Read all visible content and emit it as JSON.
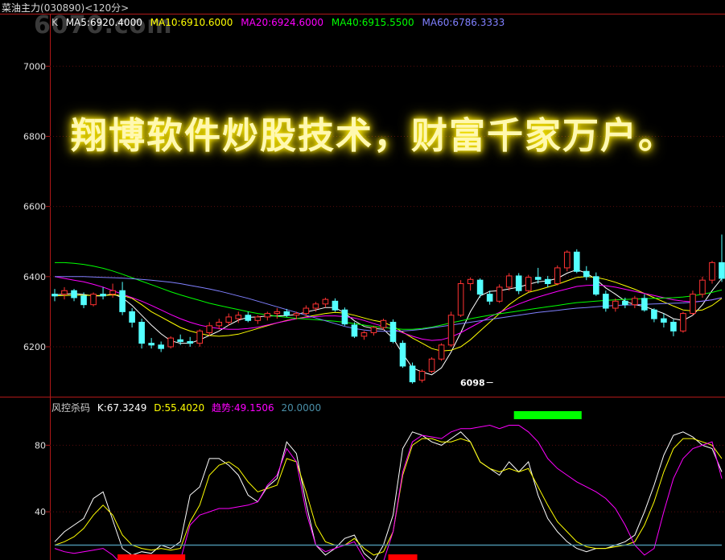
{
  "header": {
    "instrument": "菜油主力",
    "code": "(030890)",
    "period": "<120分>",
    "watermark": "6070.com"
  },
  "overlay_text": "翔博软件炒股技术，财富千家万户。",
  "ma_legend": [
    {
      "label": "K",
      "color": "#cfcfcf"
    },
    {
      "label": "MA5:6920.4000",
      "color": "#ffffff"
    },
    {
      "label": "MA10:6910.6000",
      "color": "#ffff00"
    },
    {
      "label": "MA20:6924.6000",
      "color": "#ff00ff"
    },
    {
      "label": "MA40:6915.5500",
      "color": "#00ff00"
    },
    {
      "label": "MA60:6786.3333",
      "color": "#8080ff"
    }
  ],
  "indicator_legend": [
    {
      "label": "风控杀码",
      "color": "#cfcfcf"
    },
    {
      "label": "K:67.3249",
      "color": "#ffffff"
    },
    {
      "label": "D:55.4020",
      "color": "#ffff00"
    },
    {
      "label": "趋势:49.1506",
      "color": "#ff00ff"
    },
    {
      "label": "20.0000",
      "color": "#4a8fa8"
    }
  ],
  "chart_data": [
    {
      "type": "candlestick",
      "title": "菜油主力 (030890) <120分>",
      "ylim": [
        6060,
        7120
      ],
      "yticks": [
        6200,
        6400,
        6600,
        6800,
        7000
      ],
      "annotations": [
        {
          "text": "6098",
          "bar": 45,
          "value": 6098
        }
      ],
      "candles": [
        [
          6350,
          6365,
          6330,
          6345
        ],
        [
          6350,
          6370,
          6335,
          6360
        ],
        [
          6360,
          6365,
          6330,
          6340
        ],
        [
          6345,
          6355,
          6310,
          6320
        ],
        [
          6320,
          6355,
          6315,
          6350
        ],
        [
          6350,
          6370,
          6335,
          6345
        ],
        [
          6350,
          6380,
          6340,
          6360
        ],
        [
          6360,
          6385,
          6290,
          6300
        ],
        [
          6300,
          6310,
          6255,
          6270
        ],
        [
          6270,
          6280,
          6195,
          6210
        ],
        [
          6210,
          6225,
          6195,
          6205
        ],
        [
          6205,
          6215,
          6185,
          6195
        ],
        [
          6200,
          6230,
          6195,
          6225
        ],
        [
          6220,
          6235,
          6205,
          6215
        ],
        [
          6215,
          6228,
          6200,
          6210
        ],
        [
          6210,
          6250,
          6200,
          6245
        ],
        [
          6240,
          6270,
          6232,
          6260
        ],
        [
          6260,
          6280,
          6250,
          6270
        ],
        [
          6270,
          6295,
          6260,
          6285
        ],
        [
          6280,
          6300,
          6268,
          6290
        ],
        [
          6290,
          6300,
          6270,
          6275
        ],
        [
          6275,
          6290,
          6265,
          6285
        ],
        [
          6285,
          6300,
          6275,
          6295
        ],
        [
          6295,
          6310,
          6280,
          6300
        ],
        [
          6300,
          6308,
          6285,
          6290
        ],
        [
          6290,
          6300,
          6278,
          6295
        ],
        [
          6295,
          6318,
          6288,
          6310
        ],
        [
          6310,
          6328,
          6300,
          6322
        ],
        [
          6322,
          6340,
          6312,
          6335
        ],
        [
          6330,
          6338,
          6300,
          6305
        ],
        [
          6305,
          6312,
          6260,
          6265
        ],
        [
          6262,
          6270,
          6225,
          6230
        ],
        [
          6230,
          6245,
          6220,
          6240
        ],
        [
          6240,
          6260,
          6232,
          6255
        ],
        [
          6255,
          6280,
          6248,
          6275
        ],
        [
          6270,
          6278,
          6210,
          6215
        ],
        [
          6210,
          6218,
          6140,
          6145
        ],
        [
          6145,
          6155,
          6095,
          6100
        ],
        [
          6105,
          6135,
          6098,
          6130
        ],
        [
          6130,
          6170,
          6125,
          6165
        ],
        [
          6165,
          6210,
          6160,
          6205
        ],
        [
          6205,
          6300,
          6200,
          6290
        ],
        [
          6290,
          6390,
          6285,
          6380
        ],
        [
          6380,
          6398,
          6360,
          6392
        ],
        [
          6390,
          6395,
          6340,
          6350
        ],
        [
          6350,
          6360,
          6320,
          6330
        ],
        [
          6330,
          6378,
          6325,
          6370
        ],
        [
          6370,
          6410,
          6360,
          6402
        ],
        [
          6402,
          6410,
          6350,
          6360
        ],
        [
          6360,
          6405,
          6355,
          6398
        ],
        [
          6398,
          6425,
          6380,
          6392
        ],
        [
          6392,
          6402,
          6370,
          6380
        ],
        [
          6380,
          6432,
          6375,
          6425
        ],
        [
          6425,
          6475,
          6415,
          6470
        ],
        [
          6470,
          6478,
          6410,
          6415
        ],
        [
          6415,
          6430,
          6390,
          6400
        ],
        [
          6400,
          6412,
          6345,
          6350
        ],
        [
          6350,
          6360,
          6300,
          6310
        ],
        [
          6310,
          6338,
          6300,
          6330
        ],
        [
          6330,
          6340,
          6310,
          6320
        ],
        [
          6320,
          6345,
          6310,
          6338
        ],
        [
          6338,
          6350,
          6300,
          6305
        ],
        [
          6305,
          6310,
          6270,
          6280
        ],
        [
          6280,
          6295,
          6255,
          6270
        ],
        [
          6270,
          6278,
          6230,
          6245
        ],
        [
          6245,
          6300,
          6240,
          6295
        ],
        [
          6295,
          6360,
          6290,
          6350
        ],
        [
          6350,
          6400,
          6340,
          6390
        ],
        [
          6390,
          6445,
          6380,
          6440
        ],
        [
          6440,
          6520,
          6385,
          6395
        ]
      ],
      "series": [
        {
          "name": "MA5",
          "color": "#ffffff",
          "values": [
            6348,
            6350,
            6352,
            6349,
            6345,
            6345,
            6351,
            6340,
            6318,
            6290,
            6262,
            6237,
            6217,
            6210,
            6210,
            6220,
            6232,
            6245,
            6262,
            6276,
            6284,
            6285,
            6288,
            6288,
            6289,
            6292,
            6299,
            6305,
            6312,
            6312,
            6296,
            6274,
            6258,
            6252,
            6250,
            6224,
            6180,
            6140,
            6128,
            6120,
            6140,
            6185,
            6240,
            6300,
            6345,
            6358,
            6360,
            6365,
            6370,
            6378,
            6385,
            6388,
            6395,
            6410,
            6420,
            6410,
            6392,
            6368,
            6350,
            6330,
            6320,
            6315,
            6305,
            6295,
            6280,
            6275,
            6290,
            6320,
            6360,
            6395
          ]
        },
        {
          "name": "MA10",
          "color": "#ffff00",
          "values": [
            6345,
            6346,
            6347,
            6347,
            6346,
            6346,
            6348,
            6346,
            6338,
            6320,
            6300,
            6285,
            6270,
            6255,
            6245,
            6238,
            6232,
            6230,
            6232,
            6236,
            6244,
            6252,
            6260,
            6268,
            6275,
            6280,
            6285,
            6290,
            6295,
            6298,
            6296,
            6290,
            6282,
            6275,
            6270,
            6258,
            6242,
            6225,
            6210,
            6195,
            6188,
            6190,
            6200,
            6220,
            6245,
            6270,
            6295,
            6320,
            6340,
            6355,
            6362,
            6370,
            6378,
            6388,
            6398,
            6400,
            6398,
            6392,
            6384,
            6374,
            6364,
            6352,
            6340,
            6328,
            6316,
            6305,
            6302,
            6305,
            6318,
            6338
          ]
        },
        {
          "name": "MA20",
          "color": "#ff00ff",
          "values": [
            6400,
            6395,
            6390,
            6385,
            6378,
            6370,
            6360,
            6350,
            6340,
            6330,
            6318,
            6305,
            6292,
            6280,
            6270,
            6262,
            6256,
            6252,
            6250,
            6250,
            6252,
            6256,
            6262,
            6268,
            6274,
            6280,
            6284,
            6286,
            6288,
            6288,
            6286,
            6282,
            6275,
            6266,
            6258,
            6250,
            6240,
            6230,
            6222,
            6218,
            6220,
            6228,
            6240,
            6255,
            6270,
            6285,
            6298,
            6310,
            6322,
            6332,
            6342,
            6350,
            6358,
            6365,
            6372,
            6375,
            6376,
            6374,
            6370,
            6364,
            6358,
            6352,
            6346,
            6340,
            6334,
            6330,
            6328,
            6330,
            6334,
            6340
          ]
        },
        {
          "name": "MA40",
          "color": "#00ff00",
          "values": [
            6440,
            6440,
            6438,
            6435,
            6430,
            6424,
            6416,
            6407,
            6397,
            6387,
            6377,
            6367,
            6357,
            6348,
            6340,
            6332,
            6324,
            6318,
            6312,
            6306,
            6300,
            6295,
            6291,
            6287,
            6284,
            6281,
            6279,
            6277,
            6275,
            6273,
            6270,
            6266,
            6262,
            6258,
            6255,
            6252,
            6250,
            6250,
            6252,
            6256,
            6262,
            6268,
            6274,
            6280,
            6285,
            6290,
            6294,
            6298,
            6302,
            6306,
            6310,
            6314,
            6318,
            6322,
            6326,
            6328,
            6330,
            6332,
            6334,
            6335,
            6336,
            6337,
            6338,
            6339,
            6340,
            6342,
            6345,
            6350,
            6355,
            6362
          ]
        },
        {
          "name": "MA60",
          "color": "#8080ff",
          "values": [
            6400,
            6400,
            6400,
            6400,
            6399,
            6398,
            6397,
            6396,
            6394,
            6392,
            6390,
            6387,
            6384,
            6380,
            6375,
            6370,
            6365,
            6359,
            6352,
            6345,
            6338,
            6330,
            6322,
            6314,
            6306,
            6298,
            6290,
            6282,
            6274,
            6266,
            6258,
            6252,
            6248,
            6245,
            6244,
            6244,
            6245,
            6247,
            6250,
            6254,
            6258,
            6262,
            6266,
            6270,
            6274,
            6278,
            6282,
            6286,
            6290,
            6294,
            6298,
            6301,
            6304,
            6307,
            6310,
            6312,
            6314,
            6316,
            6318,
            6319,
            6320,
            6321,
            6322,
            6323,
            6324,
            6325,
            6327,
            6330,
            6334,
            6340
          ]
        }
      ]
    },
    {
      "type": "line",
      "title": "风控杀码",
      "ylim": [
        12,
        100
      ],
      "yticks": [
        40,
        80
      ],
      "series": [
        {
          "name": "K",
          "color": "#ffffff",
          "values": [
            22,
            28,
            32,
            36,
            48,
            52,
            35,
            18,
            14,
            16,
            15,
            20,
            18,
            22,
            50,
            55,
            72,
            72,
            68,
            62,
            50,
            46,
            55,
            60,
            82,
            75,
            45,
            20,
            14,
            18,
            24,
            26,
            15,
            10,
            20,
            38,
            78,
            88,
            86,
            82,
            80,
            84,
            88,
            82,
            70,
            66,
            62,
            70,
            64,
            70,
            50,
            36,
            28,
            22,
            18,
            16,
            18,
            18,
            20,
            22,
            26,
            40,
            56,
            74,
            86,
            88,
            85,
            80,
            78,
            64
          ]
        },
        {
          "name": "D",
          "color": "#ffff00",
          "values": [
            20,
            22,
            25,
            30,
            38,
            44,
            38,
            26,
            20,
            18,
            17,
            18,
            17,
            18,
            34,
            44,
            62,
            68,
            70,
            66,
            58,
            52,
            54,
            56,
            72,
            70,
            52,
            32,
            22,
            20,
            20,
            24,
            18,
            14,
            16,
            28,
            62,
            80,
            84,
            84,
            82,
            82,
            84,
            82,
            70,
            66,
            64,
            66,
            64,
            66,
            55,
            44,
            34,
            28,
            22,
            19,
            18,
            18,
            19,
            20,
            22,
            32,
            46,
            64,
            78,
            84,
            84,
            82,
            80,
            72
          ]
        },
        {
          "name": "趋势",
          "color": "#ff00ff",
          "values": [
            18,
            16,
            15,
            16,
            17,
            18,
            14,
            8,
            6,
            6,
            7,
            8,
            9,
            11,
            32,
            38,
            40,
            42,
            42,
            43,
            44,
            46,
            56,
            62,
            78,
            70,
            40,
            20,
            16,
            18,
            20,
            22,
            12,
            6,
            10,
            28,
            64,
            82,
            86,
            85,
            84,
            88,
            90,
            90,
            91,
            92,
            90,
            92,
            92,
            88,
            82,
            72,
            66,
            62,
            58,
            55,
            52,
            48,
            42,
            32,
            20,
            14,
            18,
            40,
            60,
            72,
            78,
            80,
            82,
            60
          ]
        },
        {
          "name": "",
          "color": "#4a8fa8",
          "values": [
            20,
            20,
            20,
            20,
            20,
            20,
            20,
            20,
            20,
            20,
            20,
            20,
            20,
            20,
            20,
            20,
            20,
            20,
            20,
            20,
            20,
            20,
            20,
            20,
            20,
            20,
            20,
            20,
            20,
            20,
            20,
            20,
            20,
            20,
            20,
            20,
            20,
            20,
            20,
            20,
            20,
            20,
            20,
            20,
            20,
            20,
            20,
            20,
            20,
            20,
            20,
            20,
            20,
            20,
            20,
            20,
            20,
            20,
            20,
            20,
            20,
            20,
            20,
            20,
            20,
            20,
            20,
            20,
            20,
            20
          ]
        }
      ],
      "signals": [
        {
          "color": "#ff0000",
          "from_bar": 7,
          "to_bar": 13,
          "level": "bottom"
        },
        {
          "color": "#ff0000",
          "from_bar": 35,
          "to_bar": 37,
          "level": "bottom"
        },
        {
          "color": "#00ff00",
          "from_bar": 48,
          "to_bar": 54,
          "level": "top"
        }
      ]
    }
  ]
}
